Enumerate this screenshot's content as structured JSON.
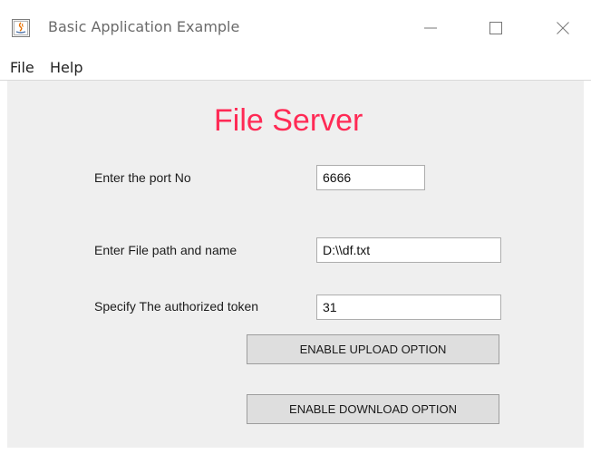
{
  "window": {
    "title": "Basic Application Example",
    "icon": "java-app-icon",
    "controls": [
      "minimize-icon",
      "maximize-icon",
      "close-icon"
    ]
  },
  "menubar": {
    "items": [
      {
        "label": "File"
      },
      {
        "label": "Help"
      }
    ]
  },
  "main": {
    "heading": "File Server",
    "heading_color": "#ff2a55",
    "port": {
      "label": "Enter the port No",
      "value": "6666"
    },
    "file_path": {
      "label": "Enter File path and name",
      "value": "D:\\\\df.txt"
    },
    "token": {
      "label": "Specify The authorized token",
      "value": "31"
    },
    "upload_button": "ENABLE UPLOAD OPTION",
    "download_button": "ENABLE DOWNLOAD OPTION"
  }
}
